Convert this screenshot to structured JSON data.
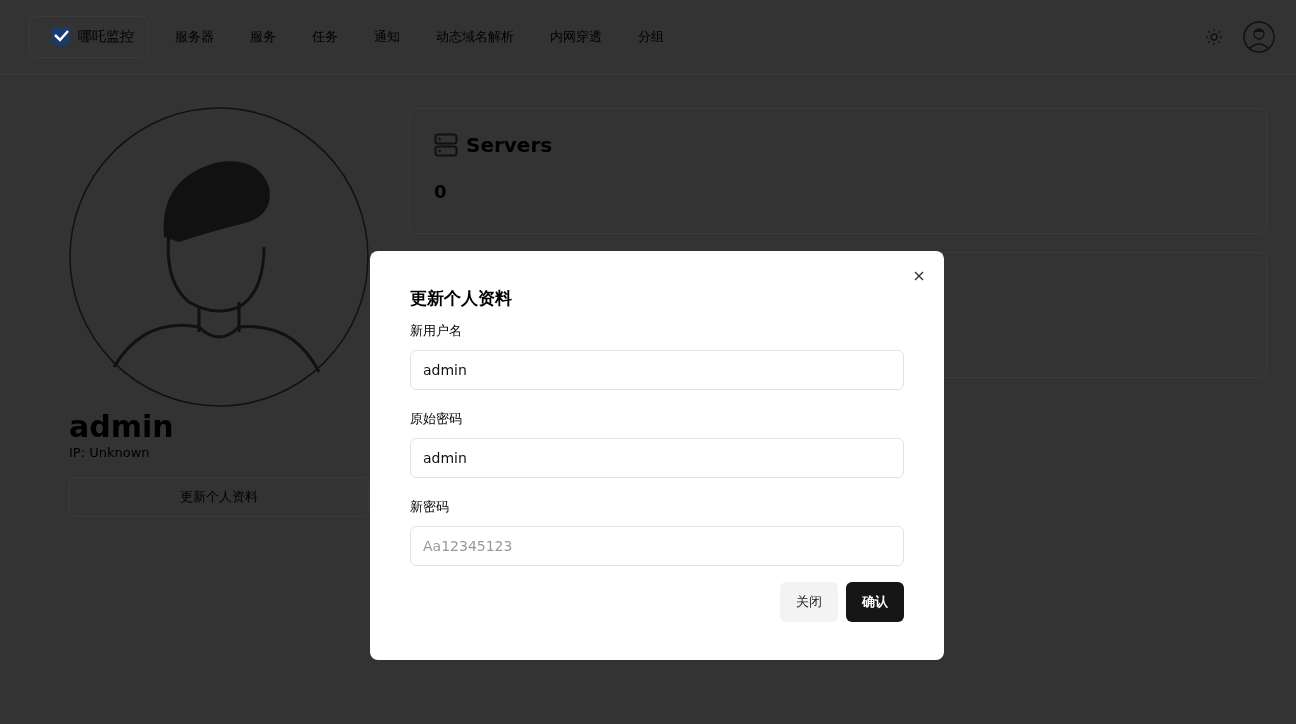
{
  "nav": {
    "brand": "哪吒监控",
    "links": [
      "服务器",
      "服务",
      "任务",
      "通知",
      "动态域名解析",
      "内网穿透",
      "分组"
    ]
  },
  "profile": {
    "username": "admin",
    "ip": "IP: Unknown",
    "edit_button": "更新个人资料"
  },
  "cards": [
    {
      "title": "Servers",
      "value": "0"
    }
  ],
  "dialog": {
    "title": "更新个人资料",
    "fields": [
      {
        "label": "新用户名",
        "value": "admin"
      },
      {
        "label": "原始密码",
        "value": "admin"
      },
      {
        "label": "新密码",
        "placeholder": "Aa12345123"
      }
    ],
    "buttons": [
      {
        "label": "关闭",
        "kind": "secondary"
      },
      {
        "label": "确认",
        "kind": "primary"
      }
    ]
  }
}
